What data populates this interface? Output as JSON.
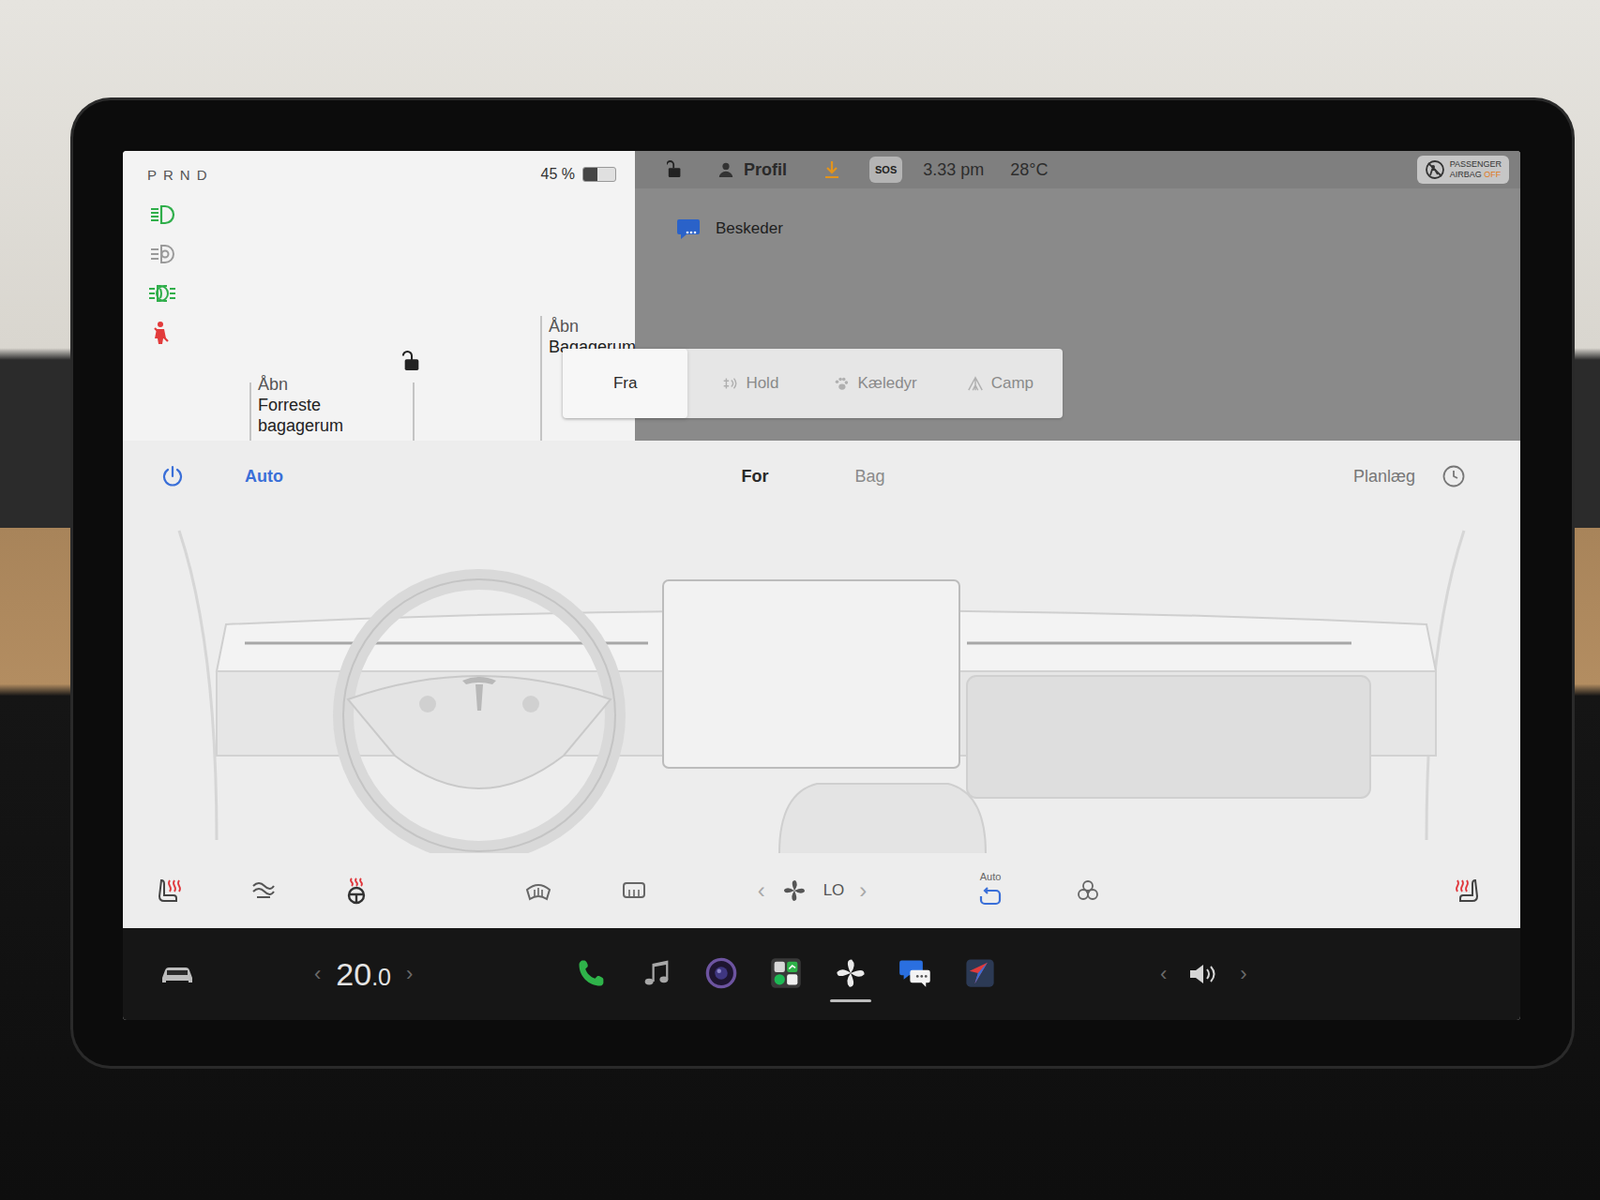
{
  "gear": [
    "P",
    "R",
    "N",
    "D"
  ],
  "battery": {
    "reading": "45 %",
    "level": 0.45
  },
  "indicators": [
    {
      "kind": "headlights",
      "color": "#2fae4a"
    },
    {
      "kind": "auto-high-beam",
      "color": "#9a9a9a"
    },
    {
      "kind": "fog-lights",
      "color": "#2fae4a"
    },
    {
      "kind": "seatbelt-warning",
      "color": "#e23b3b"
    }
  ],
  "trunks": [
    {
      "lines": [
        "Åbn",
        "Forreste",
        "bagagerum"
      ]
    },
    {
      "lines": [
        "Åbn",
        "Bagagerum"
      ]
    }
  ],
  "doors": {
    "locked": false
  },
  "status_bar": {
    "locked": false,
    "profile": "Profil",
    "update_pending": true,
    "sos": "SOS",
    "time": "3.33 pm",
    "temperature": "28°C",
    "airbag": {
      "lines": [
        "PASSENGER",
        "AIRBAG"
      ],
      "state": "OFF"
    }
  },
  "messages": {
    "title": "Beskeder"
  },
  "climate_keeper": {
    "options": [
      {
        "label": "Fra",
        "kind": "off",
        "selected": true
      },
      {
        "label": "Hold",
        "kind": "keep",
        "selected": false
      },
      {
        "label": "Kæledyr",
        "kind": "dog",
        "selected": false
      },
      {
        "label": "Camp",
        "kind": "camp",
        "selected": false
      }
    ]
  },
  "climate": {
    "power_on": true,
    "auto": {
      "label": "Auto",
      "on": true
    },
    "zones": [
      {
        "label": "For",
        "selected": true
      },
      {
        "label": "Bag",
        "selected": false
      }
    ],
    "schedule": "Planlæg",
    "controls": [
      {
        "kind": "seat-heat",
        "on": true
      },
      {
        "kind": "airflow",
        "on": false
      },
      {
        "kind": "wheel-heat",
        "on": true
      },
      {
        "kind": "front-defrost",
        "on": false
      },
      {
        "kind": "rear-defrost",
        "on": false
      },
      {
        "kind": "fan",
        "reading": "LO",
        "prev": "‹",
        "next": "›"
      },
      {
        "kind": "recirculate",
        "on": true,
        "label": "Auto"
      },
      {
        "kind": "bioweapon-mode",
        "on": false
      },
      {
        "kind": "seat-heat",
        "on": true
      }
    ]
  },
  "dock": {
    "temperature": {
      "whole": "20",
      "decimal": ".0",
      "prev": "‹",
      "next": "›"
    },
    "apps": [
      {
        "kind": "phone",
        "selected": false
      },
      {
        "kind": "music",
        "selected": false
      },
      {
        "kind": "camera",
        "selected": false
      },
      {
        "kind": "apps",
        "selected": false
      },
      {
        "kind": "climate",
        "selected": true
      },
      {
        "kind": "messages",
        "selected": false
      },
      {
        "kind": "navigation",
        "selected": false
      }
    ],
    "volume": {
      "prev": "‹",
      "next": "›"
    }
  }
}
